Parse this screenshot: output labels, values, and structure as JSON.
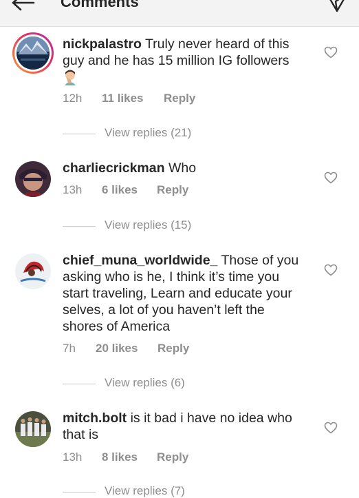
{
  "header": {
    "title": "Comments"
  },
  "comments": [
    {
      "username": "nickpalastro",
      "text": "Truly never heard of this guy and he has 15 million IG followers",
      "time": "12h",
      "likes": "11 likes",
      "reply": "Reply",
      "view_replies": "View replies (21)"
    },
    {
      "username": "charliecrickman",
      "text": "Who",
      "time": "13h",
      "likes": "6 likes",
      "reply": "Reply",
      "view_replies": "View replies (15)"
    },
    {
      "username": "chief_muna_worldwide_",
      "text": "Those of you asking who is he, I think it’s time you start traveling, Learn and educate your selves, a lot of you haven’t left the shores of America",
      "time": "7h",
      "likes": "20 likes",
      "reply": "Reply",
      "view_replies": "View replies (6)"
    },
    {
      "username": "mitch.bolt",
      "text": "is it bad i have no idea who that is",
      "time": "13h",
      "likes": "8 likes",
      "reply": "Reply",
      "view_replies": "View replies (7)"
    }
  ],
  "icons": {
    "back": "arrow-left-icon",
    "send": "send-icon",
    "heart": "heart-outline-icon",
    "emoji": "facepalm-emoji"
  }
}
